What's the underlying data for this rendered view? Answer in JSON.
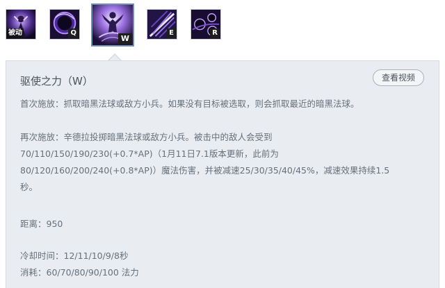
{
  "skills": [
    {
      "id": "passive",
      "key": "被动",
      "icon": "syndra-passive-icon",
      "active": false
    },
    {
      "id": "q",
      "key": "Q",
      "icon": "dark-sphere-icon",
      "active": false
    },
    {
      "id": "w",
      "key": "W",
      "icon": "force-of-will-icon",
      "active": true
    },
    {
      "id": "e",
      "key": "E",
      "icon": "scatter-the-weak-icon",
      "active": false
    },
    {
      "id": "r",
      "key": "R",
      "icon": "unleashed-power-icon",
      "active": false
    }
  ],
  "panel": {
    "title": "驱使之力（W）",
    "video_button": "查看视频",
    "first_cast": "首次施放：抓取暗黑法球或敌方小兵。如果没有目标被选取，则会抓取最近的暗黑法球。",
    "recast_line1": "再次施放：辛德拉投掷暗黑法球或敌方小兵。被击中的敌人会受到",
    "recast_line2": "70/110/150/190/230(+0.7*AP)（1月11日7.1版本更新，此前为",
    "recast_line3": "80/120/160/200/240(+0.8*AP)）魔法伤害，并被减速25/30/35/40/45%，减速效果持续1.5",
    "recast_line4": "秒。",
    "range": "距离：950",
    "cooldown": "冷却时间：12/11/10/9/8秒",
    "cost": "消耗：60/70/80/90/100 法力"
  },
  "colors": {
    "panel_bg": "#e9edf1",
    "active_border": "#6f8fb3",
    "text": "#66707b"
  }
}
